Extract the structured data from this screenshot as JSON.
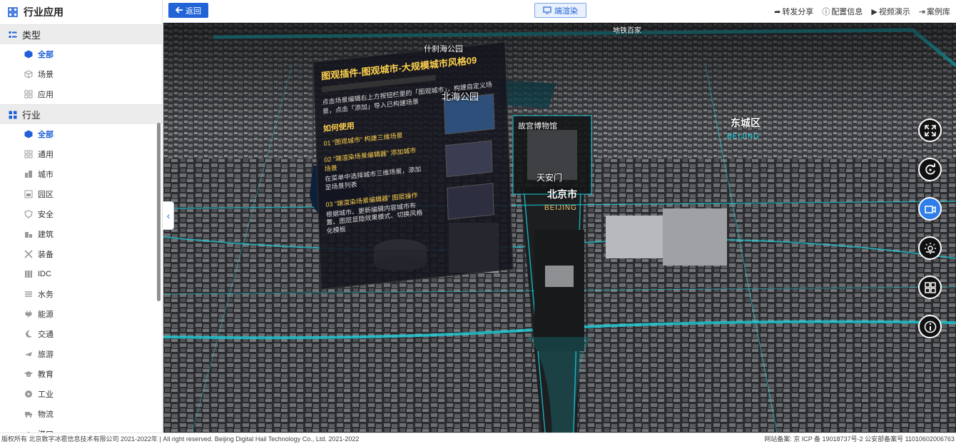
{
  "sidebar": {
    "title": "行业应用",
    "groups": [
      {
        "label": "类型",
        "items": [
          {
            "label": "全部",
            "icon": "cube-icon",
            "active": true
          },
          {
            "label": "场景",
            "icon": "cube-outline-icon",
            "active": false
          },
          {
            "label": "应用",
            "icon": "grid-icon",
            "active": false
          }
        ]
      },
      {
        "label": "行业",
        "items": [
          {
            "label": "全部",
            "icon": "cube-icon",
            "active": true
          },
          {
            "label": "通用",
            "icon": "grid-icon"
          },
          {
            "label": "城市",
            "icon": "building-icon"
          },
          {
            "label": "园区",
            "icon": "park-icon"
          },
          {
            "label": "安全",
            "icon": "shield-icon"
          },
          {
            "label": "建筑",
            "icon": "building-icon"
          },
          {
            "label": "装备",
            "icon": "tools-icon"
          },
          {
            "label": "IDC",
            "icon": "server-icon"
          },
          {
            "label": "水务",
            "icon": "water-icon"
          },
          {
            "label": "能源",
            "icon": "plug-icon"
          },
          {
            "label": "交通",
            "icon": "moon-icon"
          },
          {
            "label": "旅游",
            "icon": "plane-icon"
          },
          {
            "label": "教育",
            "icon": "graduation-cap-icon"
          },
          {
            "label": "工业",
            "icon": "radiation-icon"
          },
          {
            "label": "物流",
            "icon": "truck-icon"
          },
          {
            "label": "港口",
            "icon": "ship-icon"
          }
        ]
      }
    ]
  },
  "toolbar": {
    "back_label": "返回",
    "render_label": "端渲染",
    "actions": [
      "转发分享",
      "配置信息",
      "视频演示",
      "案例库"
    ]
  },
  "map": {
    "labels": {
      "shichahai": "什刹海公园",
      "beihai": "北海公园",
      "gugong": "故宫博物馆",
      "tiananmen": "天安门",
      "beijing_city": "北京市",
      "beijing_tag_1": "BEIJING",
      "dongcheng": "东城区",
      "beijing_tag_2": "BEIJING",
      "top_area": "地铁百家"
    },
    "panel": {
      "title": "图观插件-图观城市-大规模城市风格09",
      "intro": "点击场景编辑右上方按钮栏里的「图观城市」，构建自定义场景，点击「添加」导入已构建场景",
      "how_to": "如何使用",
      "step1": "01 “图观城市” 构建三维场景",
      "step2": "02 “端渲染场景编辑器” 添加城市场景",
      "step2b": "在菜单中选择城市三维场景，添加至场景列表",
      "step3": "03 “端渲染场景编辑器” 图层操作",
      "step3b": "根据城市、更新编辑内容城市布置、图层显隐效果模式、切换风格化模板"
    },
    "tools": [
      "expand-icon",
      "rotate-icon",
      "video-icon",
      "weather-icon",
      "grid-icon",
      "info-icon"
    ]
  },
  "footer": {
    "left": "版权所有 北京数字冰雹信息技术有限公司 2021-2022年 | All right reserved. Beijing Digital Hail Technology Co., Ltd. 2021-2022",
    "right": "网站备案: 京 ICP 备 19018737号-2 公安部备案号 11010602006763"
  },
  "colors": {
    "accent": "#2263d8",
    "cyan_glow": "#19e3f0",
    "active_tool": "#2f7de8"
  }
}
